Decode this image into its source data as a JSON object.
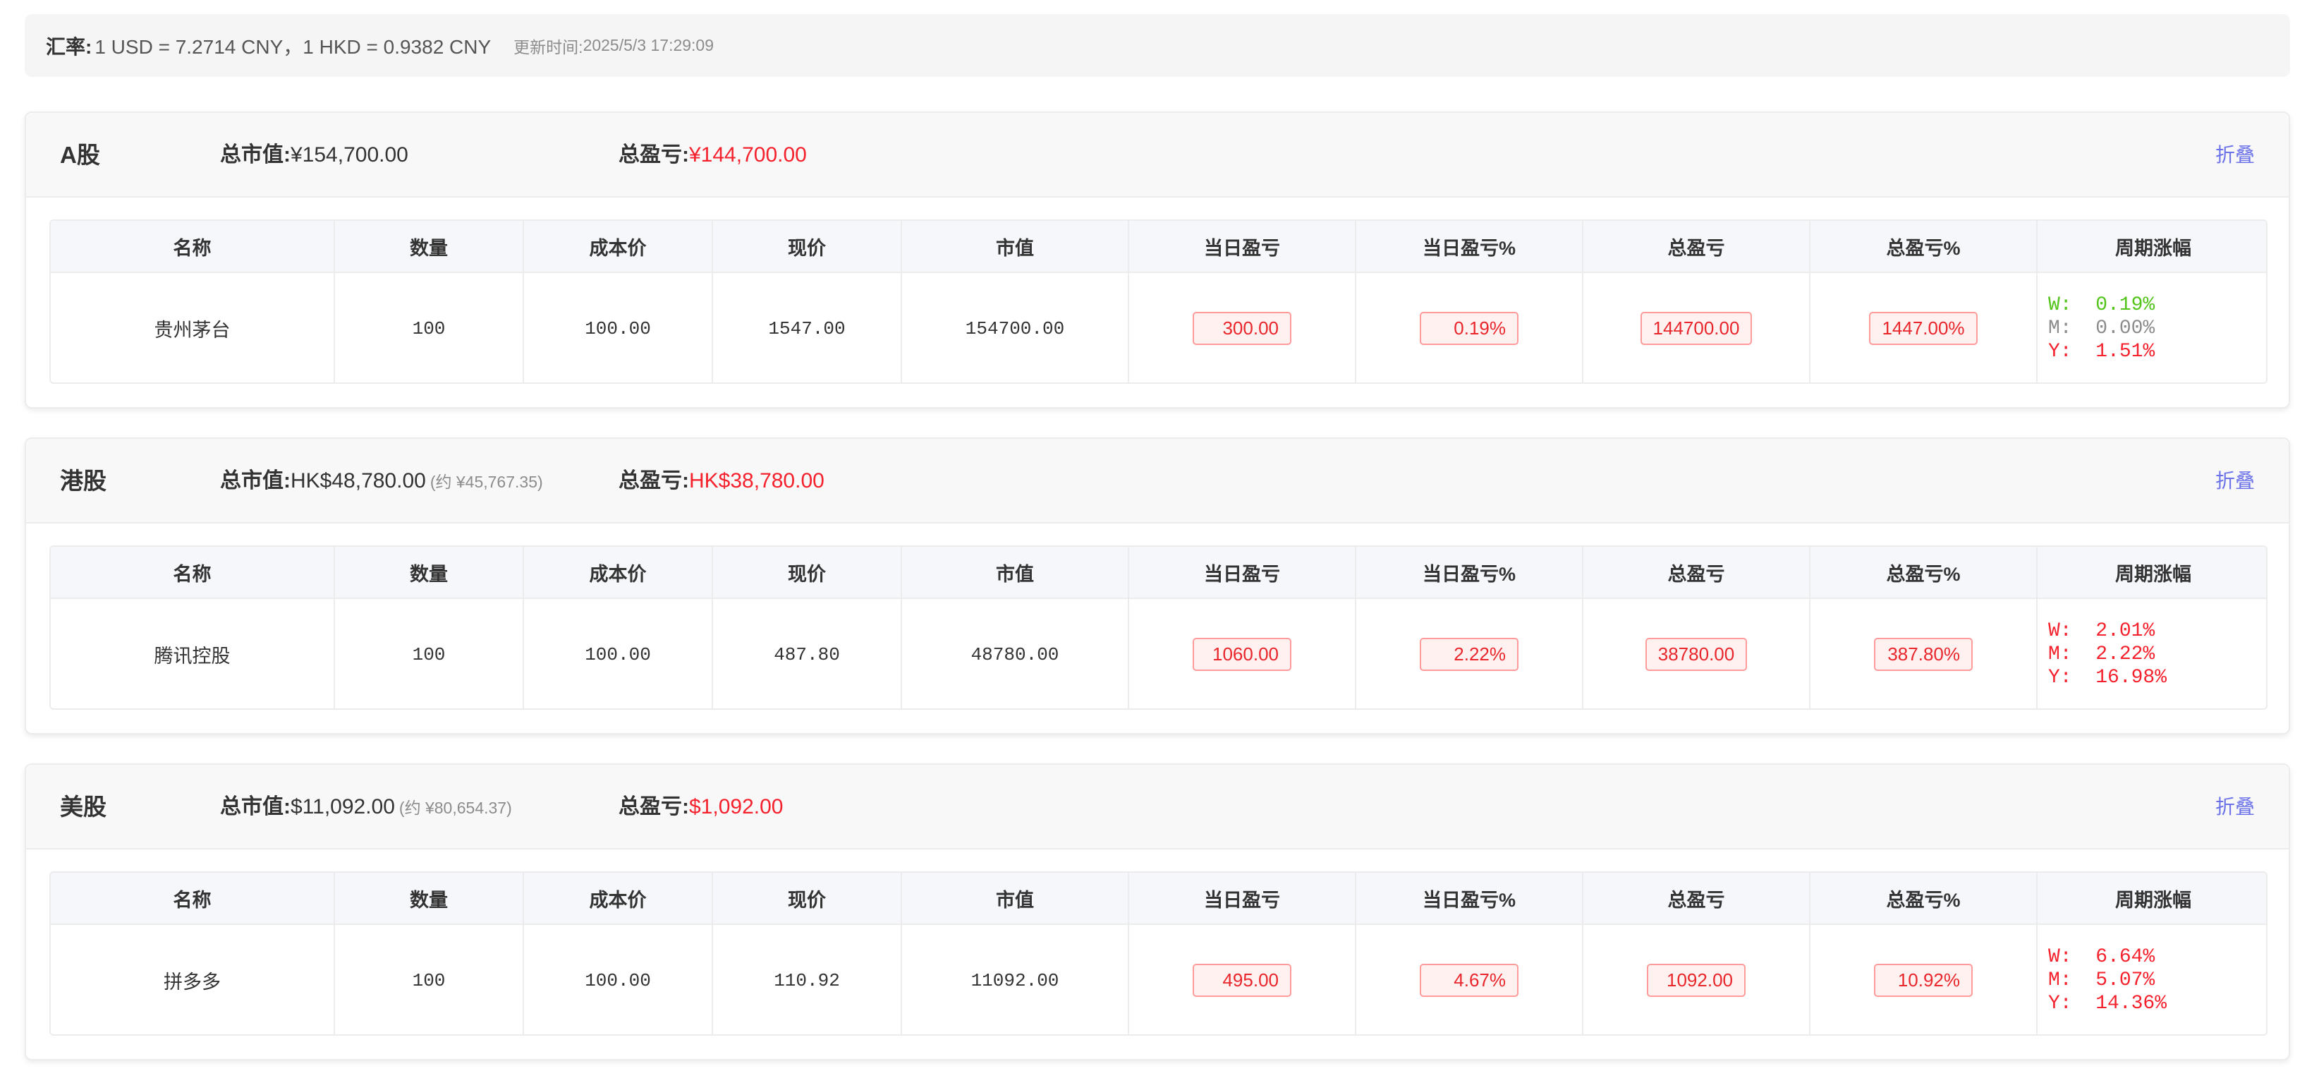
{
  "exchange_bar": {
    "label": "汇率:",
    "text": "1 USD = 7.2714 CNY，1 HKD = 0.9382 CNY",
    "update_label": "更新时间:",
    "update_time": "2025/5/3 17:29:09"
  },
  "table_headers": [
    "名称",
    "数量",
    "成本价",
    "现价",
    "市值",
    "当日盈亏",
    "当日盈亏%",
    "总盈亏",
    "总盈亏%",
    "周期涨幅"
  ],
  "sections": [
    {
      "title": "A股",
      "market_value_label": "总市值:",
      "market_value": "¥154,700.00",
      "market_value_cny": "",
      "total_pl_label": "总盈亏:",
      "total_pl": "¥144,700.00",
      "collapse_label": "折叠",
      "rows": [
        {
          "name": "贵州茅台",
          "qty": "100",
          "cost": "100.00",
          "price": "1547.00",
          "value": "154700.00",
          "day_pl": "300.00",
          "day_pl_pct": "0.19%",
          "total_pl": "144700.00",
          "total_pl_pct": "1447.00%",
          "period": {
            "w": "W:  0.19%",
            "m": "M:  0.00%",
            "y": "Y:  1.51%"
          }
        }
      ]
    },
    {
      "title": "港股",
      "market_value_label": "总市值:",
      "market_value": "HK$48,780.00",
      "market_value_cny": "(约 ¥45,767.35)",
      "total_pl_label": "总盈亏:",
      "total_pl": "HK$38,780.00",
      "collapse_label": "折叠",
      "rows": [
        {
          "name": "腾讯控股",
          "qty": "100",
          "cost": "100.00",
          "price": "487.80",
          "value": "48780.00",
          "day_pl": "1060.00",
          "day_pl_pct": "2.22%",
          "total_pl": "38780.00",
          "total_pl_pct": "387.80%",
          "period": {
            "w": "W:  2.01%",
            "m": "M:  2.22%",
            "y": "Y:  16.98%"
          }
        }
      ]
    },
    {
      "title": "美股",
      "market_value_label": "总市值:",
      "market_value": "$11,092.00",
      "market_value_cny": "(约 ¥80,654.37)",
      "total_pl_label": "总盈亏:",
      "total_pl": "$1,092.00",
      "collapse_label": "折叠",
      "rows": [
        {
          "name": "拼多多",
          "qty": "100",
          "cost": "100.00",
          "price": "110.92",
          "value": "11092.00",
          "day_pl": "495.00",
          "day_pl_pct": "4.67%",
          "total_pl": "1092.00",
          "total_pl_pct": "10.92%",
          "period": {
            "w": "W:  6.64%",
            "m": "M:  5.07%",
            "y": "Y:  14.36%"
          }
        }
      ]
    }
  ],
  "colors": {
    "profit_red": "#f5222d",
    "link_blue": "#6b72e8",
    "week_green": "#52c41a",
    "flat_gray": "#8c8c8c"
  }
}
